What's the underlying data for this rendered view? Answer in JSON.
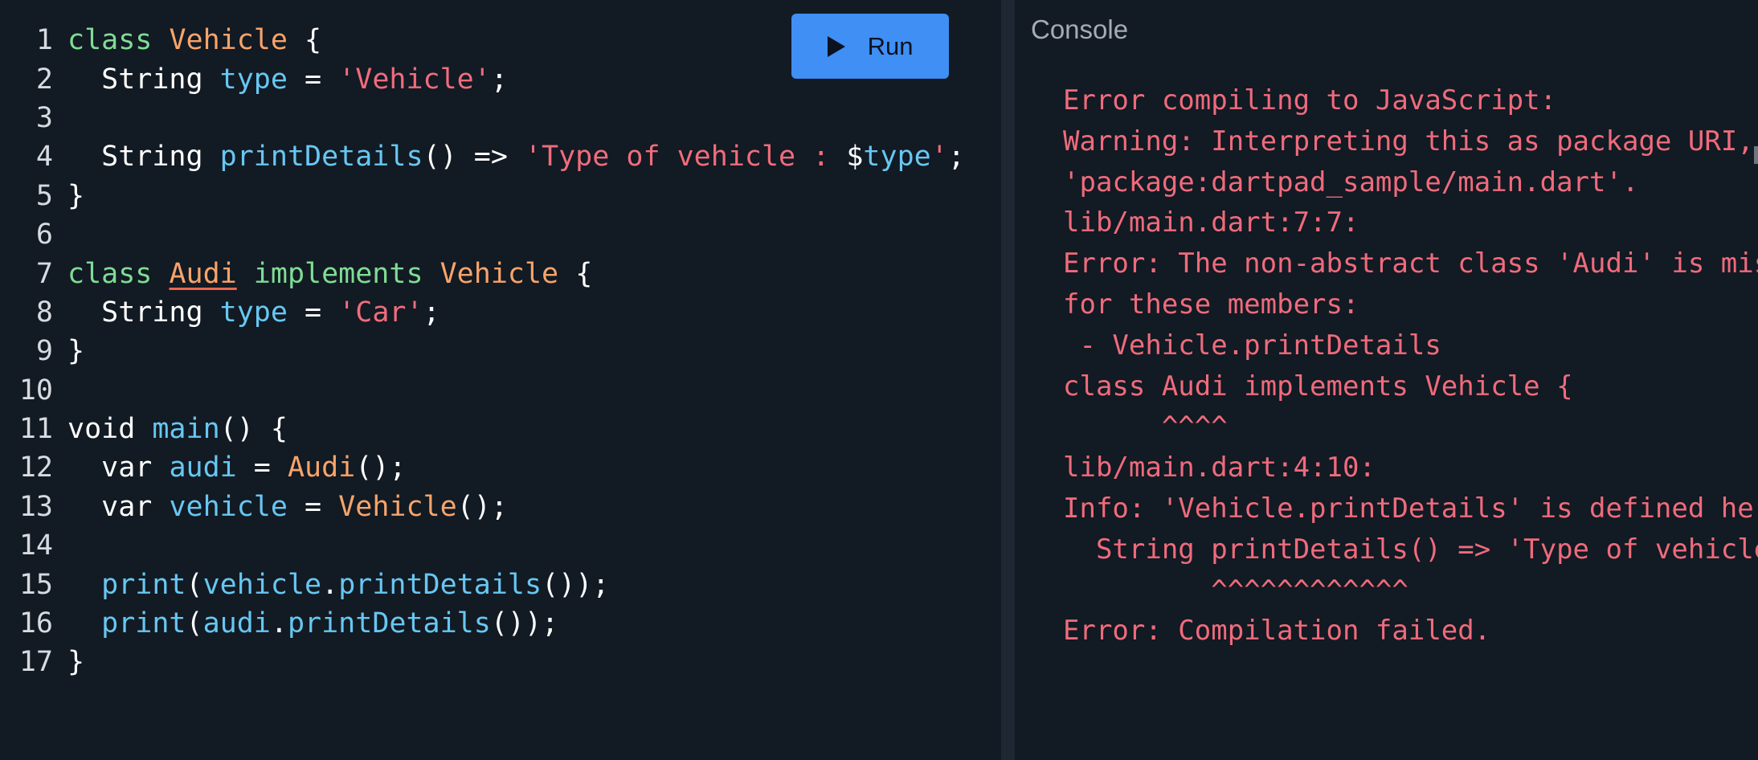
{
  "toolbar": {
    "run_label": "Run",
    "run_icon": "play-icon"
  },
  "editor": {
    "lines": [
      {
        "num": "1",
        "tokens": [
          {
            "t": "class ",
            "c": "kw"
          },
          {
            "t": "Vehicle",
            "c": "cls"
          },
          {
            "t": " {",
            "c": "pl"
          }
        ]
      },
      {
        "num": "2",
        "tokens": [
          {
            "t": "  String ",
            "c": "pl"
          },
          {
            "t": "type",
            "c": "prop"
          },
          {
            "t": " = ",
            "c": "pl"
          },
          {
            "t": "'Vehicle'",
            "c": "str"
          },
          {
            "t": ";",
            "c": "pl"
          }
        ]
      },
      {
        "num": "3",
        "tokens": []
      },
      {
        "num": "4",
        "tokens": [
          {
            "t": "  String ",
            "c": "pl"
          },
          {
            "t": "printDetails",
            "c": "prop"
          },
          {
            "t": "() => ",
            "c": "pl"
          },
          {
            "t": "'Type of vehicle : ",
            "c": "str"
          },
          {
            "t": "$",
            "c": "pl"
          },
          {
            "t": "type",
            "c": "prop"
          },
          {
            "t": "'",
            "c": "str"
          },
          {
            "t": ";",
            "c": "pl"
          }
        ]
      },
      {
        "num": "5",
        "tokens": [
          {
            "t": "}",
            "c": "pl"
          }
        ]
      },
      {
        "num": "6",
        "tokens": []
      },
      {
        "num": "7",
        "tokens": [
          {
            "t": "class ",
            "c": "kw"
          },
          {
            "t": "Audi",
            "c": "cls underline"
          },
          {
            "t": " implements ",
            "c": "kw"
          },
          {
            "t": "Vehicle",
            "c": "cls"
          },
          {
            "t": " {",
            "c": "pl"
          }
        ]
      },
      {
        "num": "8",
        "tokens": [
          {
            "t": "  String ",
            "c": "pl"
          },
          {
            "t": "type",
            "c": "prop"
          },
          {
            "t": " = ",
            "c": "pl"
          },
          {
            "t": "'Car'",
            "c": "str"
          },
          {
            "t": ";",
            "c": "pl"
          }
        ]
      },
      {
        "num": "9",
        "tokens": [
          {
            "t": "}",
            "c": "pl"
          }
        ]
      },
      {
        "num": "10",
        "tokens": []
      },
      {
        "num": "11",
        "tokens": [
          {
            "t": "void ",
            "c": "pl"
          },
          {
            "t": "main",
            "c": "prop"
          },
          {
            "t": "() {",
            "c": "pl"
          }
        ]
      },
      {
        "num": "12",
        "tokens": [
          {
            "t": "  var ",
            "c": "pl"
          },
          {
            "t": "audi",
            "c": "prop"
          },
          {
            "t": " = ",
            "c": "pl"
          },
          {
            "t": "Audi",
            "c": "cls"
          },
          {
            "t": "();",
            "c": "pl"
          }
        ]
      },
      {
        "num": "13",
        "tokens": [
          {
            "t": "  var ",
            "c": "pl"
          },
          {
            "t": "vehicle",
            "c": "prop"
          },
          {
            "t": " = ",
            "c": "pl"
          },
          {
            "t": "Vehicle",
            "c": "cls"
          },
          {
            "t": "();",
            "c": "pl"
          }
        ]
      },
      {
        "num": "14",
        "tokens": []
      },
      {
        "num": "15",
        "tokens": [
          {
            "t": "  print",
            "c": "prop"
          },
          {
            "t": "(",
            "c": "pl"
          },
          {
            "t": "vehicle",
            "c": "prop"
          },
          {
            "t": ".",
            "c": "pl"
          },
          {
            "t": "printDetails",
            "c": "prop"
          },
          {
            "t": "());",
            "c": "pl"
          }
        ]
      },
      {
        "num": "16",
        "tokens": [
          {
            "t": "  print",
            "c": "prop"
          },
          {
            "t": "(",
            "c": "pl"
          },
          {
            "t": "audi",
            "c": "prop"
          },
          {
            "t": ".",
            "c": "pl"
          },
          {
            "t": "printDetails",
            "c": "prop"
          },
          {
            "t": "());",
            "c": "pl"
          }
        ]
      },
      {
        "num": "17",
        "tokens": [
          {
            "t": "}",
            "c": "pl"
          }
        ]
      }
    ]
  },
  "console": {
    "title": "Console",
    "lines": [
      "Error compiling to JavaScript:",
      "Warning: Interpreting this as package URI,",
      "'package:dartpad_sample/main.dart'.",
      "lib/main.dart:7:7:",
      "Error: The non-abstract class 'Audi' is missing",
      "for these members:",
      " - Vehicle.printDetails",
      "class Audi implements Vehicle {",
      "      ^^^^",
      "lib/main.dart:4:10:",
      "Info: 'Vehicle.printDetails' is defined here.",
      "  String printDetails() => 'Type of vehicle",
      "         ^^^^^^^^^^^^",
      "Error: Compilation failed."
    ]
  },
  "colors": {
    "background": "#121a23",
    "run_button": "#3f8ff4",
    "error_text": "#ef6b7c",
    "keyword": "#7fdc94",
    "class_name": "#f7a46a",
    "identifier": "#67c7f2",
    "string": "#f06c7d"
  }
}
